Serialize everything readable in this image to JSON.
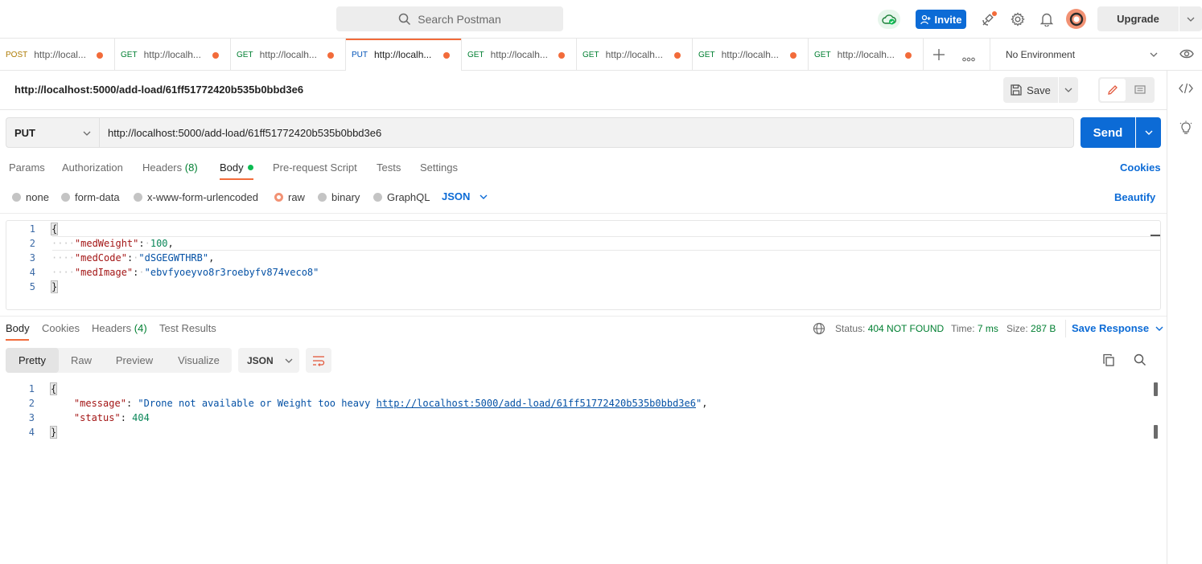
{
  "header": {
    "search_placeholder": "Search Postman",
    "invite_label": "Invite",
    "upgrade_label": "Upgrade"
  },
  "tabs": [
    {
      "method": "POST",
      "url": "http://local...",
      "active": false
    },
    {
      "method": "GET",
      "url": "http://localh...",
      "active": false
    },
    {
      "method": "GET",
      "url": "http://localh...",
      "active": false
    },
    {
      "method": "PUT",
      "url": "http://localh...",
      "active": true
    },
    {
      "method": "GET",
      "url": "http://localh...",
      "active": false
    },
    {
      "method": "GET",
      "url": "http://localh...",
      "active": false
    },
    {
      "method": "GET",
      "url": "http://localh...",
      "active": false
    },
    {
      "method": "GET",
      "url": "http://localh...",
      "active": false
    }
  ],
  "environment": "No Environment",
  "request": {
    "title": "http://localhost:5000/add-load/61ff51772420b535b0bbd3e6",
    "save_label": "Save",
    "method": "PUT",
    "url": "http://localhost:5000/add-load/61ff51772420b535b0bbd3e6",
    "send_label": "Send",
    "tabs": {
      "params": "Params",
      "authorization": "Authorization",
      "headers": "Headers",
      "headers_count": "(8)",
      "body": "Body",
      "prerequest": "Pre-request Script",
      "tests": "Tests",
      "settings": "Settings"
    },
    "cookies_label": "Cookies",
    "body_types": {
      "none": "none",
      "form_data": "form-data",
      "urlencoded": "x-www-form-urlencoded",
      "raw": "raw",
      "binary": "binary",
      "graphql": "GraphQL"
    },
    "body_format": "JSON",
    "beautify_label": "Beautify",
    "body_lines": {
      "l1": "1",
      "l2": "2",
      "l3": "3",
      "l4": "4",
      "l5": "5",
      "open": "{",
      "key1": "\"medWeight\"",
      "val1": "100",
      "key2": "\"medCode\"",
      "val2": "\"dSGEGWTHRB\"",
      "key3": "\"medImage\"",
      "val3": "\"ebvfyoeyvo8r3roebyfv874veco8\"",
      "close": "}"
    }
  },
  "response": {
    "tabs": {
      "body": "Body",
      "cookies": "Cookies",
      "headers": "Headers",
      "headers_count": "(4)",
      "test_results": "Test Results"
    },
    "status_label": "Status:",
    "status_value": "404 NOT FOUND",
    "time_label": "Time:",
    "time_value": "7 ms",
    "size_label": "Size:",
    "size_value": "287 B",
    "save_response_label": "Save Response",
    "views": {
      "pretty": "Pretty",
      "raw": "Raw",
      "preview": "Preview",
      "visualize": "Visualize"
    },
    "format": "JSON",
    "body_lines": {
      "l1": "1",
      "l2": "2",
      "l3": "3",
      "l4": "4",
      "open": "{",
      "key1": "\"message\"",
      "val1_prefix": "\"Drone not available or Weight too heavy ",
      "val1_link": "http://localhost:5000/add-load/61ff51772420b535b0bbd3e6",
      "val1_suffix": "\"",
      "key2": "\"status\"",
      "val2": "404",
      "close": "}"
    }
  },
  "colors": {
    "accent_orange": "#f26b3a",
    "primary_blue": "#0c6bd6",
    "success_green": "#007f31"
  }
}
